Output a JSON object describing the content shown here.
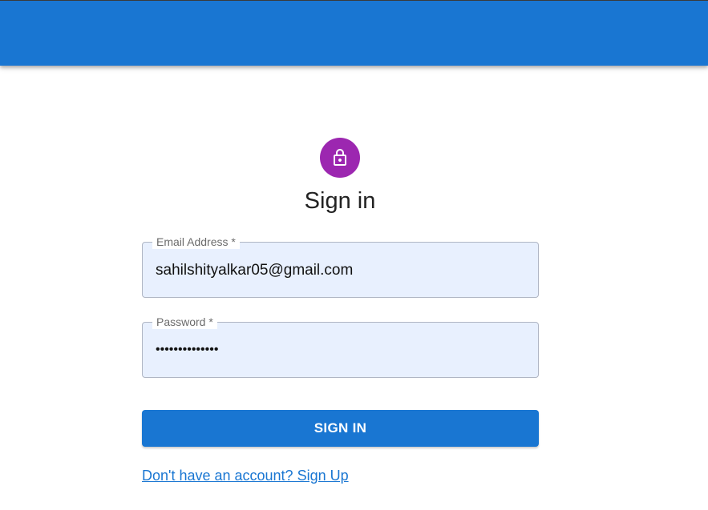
{
  "colors": {
    "primary": "#1976d2",
    "avatar": "#9c27b0",
    "field_background": "#e8f0fe"
  },
  "avatar": {
    "icon": "lock-icon"
  },
  "form": {
    "title": "Sign in",
    "email": {
      "label": "Email Address *",
      "value": "sahilshityalkar05@gmail.com"
    },
    "password": {
      "label": "Password *",
      "value": "••••••••••••••"
    },
    "submit_label": "SIGN IN",
    "signup_link": "Don't have an account? Sign Up"
  }
}
